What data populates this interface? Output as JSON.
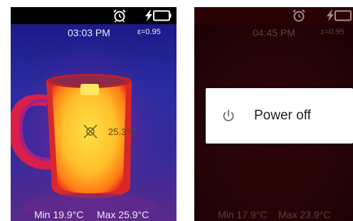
{
  "left_screen": {
    "status_icons": [
      "alarm-icon",
      "charging-battery-icon"
    ],
    "time": "03:03 PM",
    "emissivity": "ε=0.95",
    "spot_temp": "25.3°C",
    "min_label": "Min 19.9°C",
    "max_label": "Max 25.9°C",
    "crosshair_icon": "crosshair-icon"
  },
  "right_screen": {
    "status_icons": [
      "alarm-icon",
      "charging-battery-icon"
    ],
    "time": "04:45 PM",
    "emissivity": "ε=0.95",
    "min_label": "Min 17.9°C",
    "max_label": "Max 23.9°C",
    "dialog": {
      "icon": "power-icon",
      "label": "Power off"
    }
  },
  "colors": {
    "status_bar": "#000000",
    "cold": "#1a1c8c",
    "hot": "#ffd23a",
    "dialog_bg": "#ffffff"
  }
}
